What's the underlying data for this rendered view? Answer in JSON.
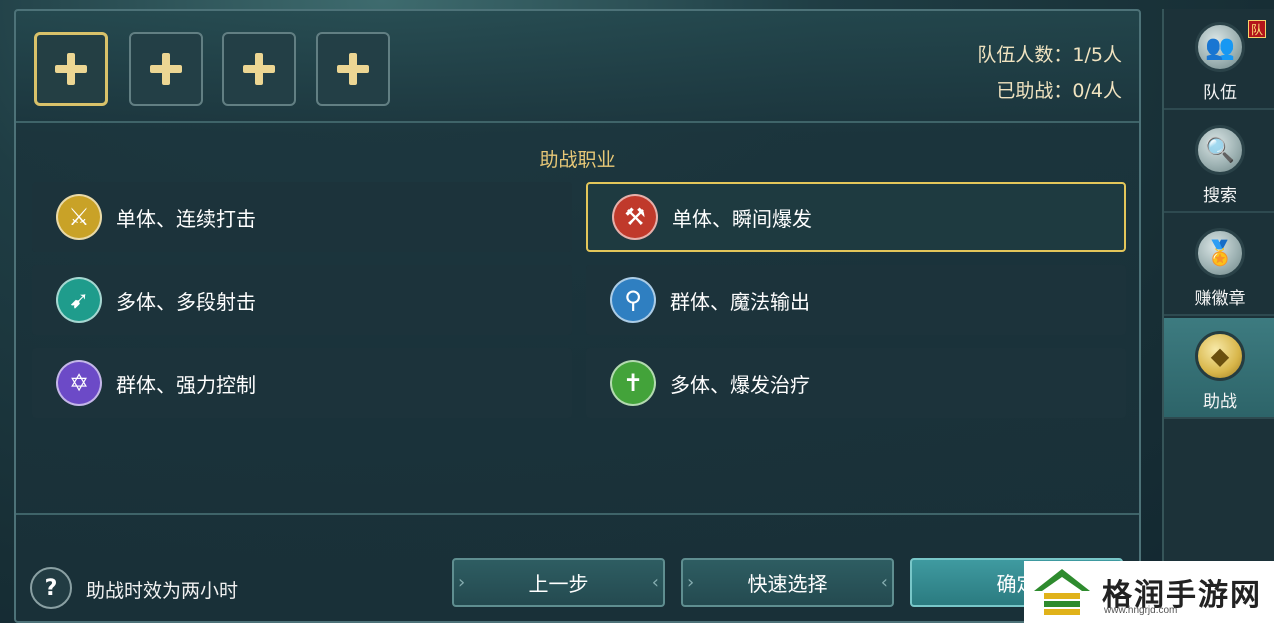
{
  "slots": [
    {
      "icon": "plus-icon",
      "selected": true
    },
    {
      "icon": "plus-icon",
      "selected": false
    },
    {
      "icon": "plus-icon",
      "selected": false
    },
    {
      "icon": "plus-icon",
      "selected": false
    }
  ],
  "team_info": {
    "member_count": "队伍人数：1/5人",
    "assist_count": "已助战：0/4人"
  },
  "section_title": "助战职业",
  "classes": [
    {
      "label": "单体、连续打击",
      "icon": "sword-icon",
      "color": "#c9a227",
      "selected": false
    },
    {
      "label": "单体、瞬间爆发",
      "icon": "axe-icon",
      "color": "#c0392b",
      "selected": true
    },
    {
      "label": "多体、多段射击",
      "icon": "bow-icon",
      "color": "#1f9c8c",
      "selected": false
    },
    {
      "label": "群体、魔法输出",
      "icon": "staff-icon",
      "color": "#2f7fc1",
      "selected": false
    },
    {
      "label": "群体、强力控制",
      "icon": "hexagram-icon",
      "color": "#6c4ac7",
      "selected": false
    },
    {
      "label": "多体、爆发治疗",
      "icon": "cross-icon",
      "color": "#43a33a",
      "selected": false
    }
  ],
  "footer": {
    "help_text": "助战时效为两小时",
    "prev_button": "上一步",
    "quick_select_button": "快速选择",
    "confirm_button": "确定"
  },
  "sidebar": {
    "items": [
      {
        "label": "队伍",
        "icon": "team-icon",
        "badge": "队",
        "active": false
      },
      {
        "label": "搜索",
        "icon": "search-icon",
        "active": false
      },
      {
        "label": "赚徽章",
        "icon": "badge-medal-icon",
        "active": false
      },
      {
        "label": "助战",
        "icon": "diamond-icon",
        "active": true
      }
    ]
  },
  "watermark": {
    "name": "格润手游网",
    "url": "www.hngrjd.com"
  }
}
